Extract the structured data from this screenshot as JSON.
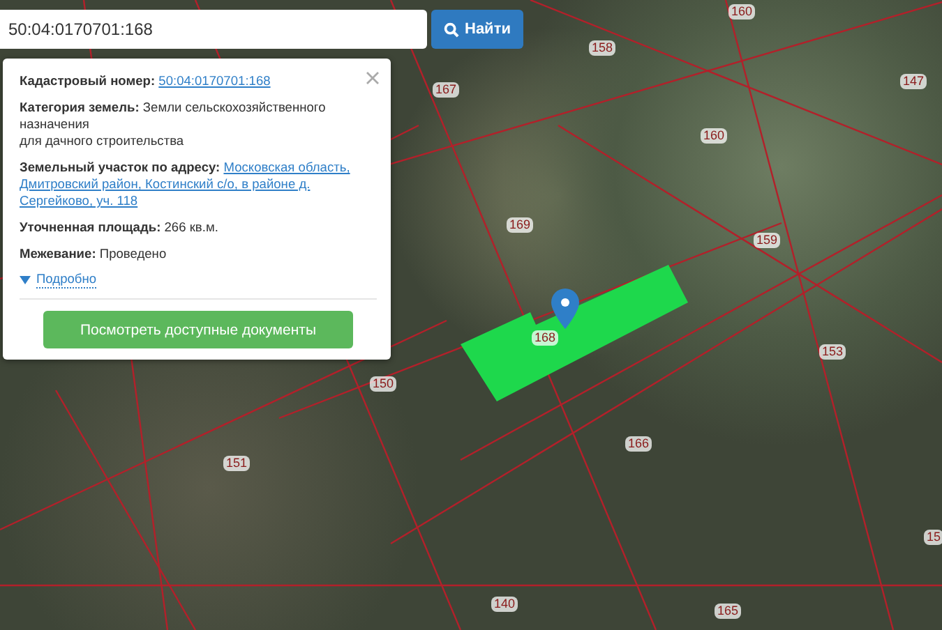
{
  "search": {
    "value": "50:04:0170701:168",
    "button": "Найти"
  },
  "parcel_labels": [
    "160",
    "158",
    "167",
    "147",
    "160",
    "169",
    "159",
    "168",
    "153",
    "150",
    "151",
    "166",
    "15",
    "140",
    "165"
  ],
  "popup": {
    "rows": [
      {
        "label": "Кадастровый номер:",
        "kind": "link",
        "lines": [
          "50:04:0170701:168"
        ]
      },
      {
        "label": "Категория земель:",
        "kind": "text",
        "lines": [
          "Земли сельскохозяйственного назначения",
          "для дачного строительства"
        ]
      },
      {
        "label": "Земельный участок по адресу:",
        "kind": "link",
        "lines": [
          "Московская область,",
          "Дмитровский район, Костинский с/о, в районе д.",
          "Сергейково, уч. 118"
        ]
      },
      {
        "label": "Уточненная площадь:",
        "kind": "text",
        "lines": [
          "266 кв.м."
        ]
      },
      {
        "label": "Межевание:",
        "kind": "text",
        "lines": [
          "Проведено"
        ]
      }
    ],
    "details": {
      "label": "Подробно",
      "expanded": false
    },
    "button": "Посмотреть доступные документы"
  }
}
